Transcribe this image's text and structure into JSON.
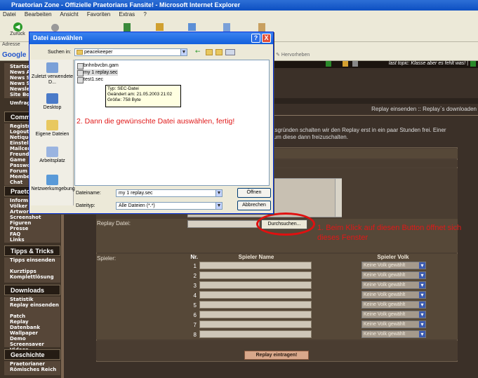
{
  "window": {
    "title": "Praetorian Zone - Offizielle Praetorians Fansite! - Microsoft Internet Explorer"
  },
  "menu": [
    "Datei",
    "Bearbeiten",
    "Ansicht",
    "Favoriten",
    "Extras",
    "?"
  ],
  "toolbar": {
    "back_label": "Zurück",
    "address_label": "Adresse",
    "google_label": "Google",
    "hervorheben_label": "Hervorheben"
  },
  "page": {
    "last_topic": "last topic: Klasse aber es fehlt was! |",
    "breadcrumb": "Replay einsenden :: Replay`s downloaden",
    "info_line1": "eitsgründen schalten wir den Replay erst in ein paar Stunden frei. Einer",
    "info_line2": "n um diese dann freizuschalten.",
    "replay_file_label": "Replay Datei:",
    "browse_label": "Durchsuchen...",
    "spieler_label": "Spieler:",
    "col_nr": "Nr.",
    "col_name": "Spieler Name",
    "col_volk": "Spieler Volk",
    "volk_default": "Keine Volk gewählt",
    "players": [
      "1",
      "2",
      "3",
      "4",
      "5",
      "6",
      "7",
      "8"
    ],
    "submit_label": "Replay eintragen!",
    "annotation1": "1. Beim Klick auf diesen Button öffnet sich dieses Fenster"
  },
  "sidebar": {
    "section1_items": [
      "Startse",
      "News A",
      "News S",
      "News S",
      "Newsle",
      "Site Bo"
    ],
    "umfrage": "Umfrag",
    "community_header": "Comm",
    "community_items": [
      "Registr",
      "Logout",
      "Netique",
      "Einstell",
      "Mailcen",
      "Freunde",
      "Game",
      "Passwo",
      "Forum",
      "Membe",
      "Chat"
    ],
    "praetorians_header": "Praetori",
    "praetorians_items": [
      "Inform",
      "Völker",
      "Artwor",
      "Screenshot",
      "Figuren",
      "Presse",
      "FAQ",
      "Links"
    ],
    "tipps_header": "Tipps & Tricks",
    "tipps_items": [
      "Tipps einsenden",
      "",
      "Kurztipps",
      "Komplettlösung"
    ],
    "downloads_header": "Downloads",
    "downloads_items": [
      "Statistik",
      "Replay einsenden",
      "",
      "Patch",
      "Replay Datenbank",
      "Wallpaper",
      "Demo",
      "Screensaver",
      "Videos"
    ],
    "geschichte_header": "Geschichte",
    "geschichte_items": [
      "Praetorianer",
      "Römisches Reich"
    ]
  },
  "dialog": {
    "title": "Datei auswählen",
    "help": "?",
    "close": "X",
    "lookin_label": "Suchen in:",
    "lookin_value": "peacekeeper",
    "places": [
      "Zuletzt verwendete D...",
      "Desktop",
      "Eigene Dateien",
      "Arbeitsplatz",
      "Netzwerkumgebung"
    ],
    "files": [
      "bnhnbvcbn.gam",
      "my 1 replay.sec",
      "test1.sec"
    ],
    "tooltip": [
      "Typ: SEC-Datei",
      "Geändert am: 21.05.2003 21:02",
      "Größe: 758 Byte"
    ],
    "annotation2": "2. Dann die gewünschte Datei auswählen, fertig!",
    "filename_label": "Dateiname:",
    "filename_value": "my 1 replay.sec",
    "filetype_label": "Dateityp:",
    "filetype_value": "Alle Dateien (*.*)",
    "open_button": "Öffnen",
    "cancel_button": "Abbrechen"
  }
}
